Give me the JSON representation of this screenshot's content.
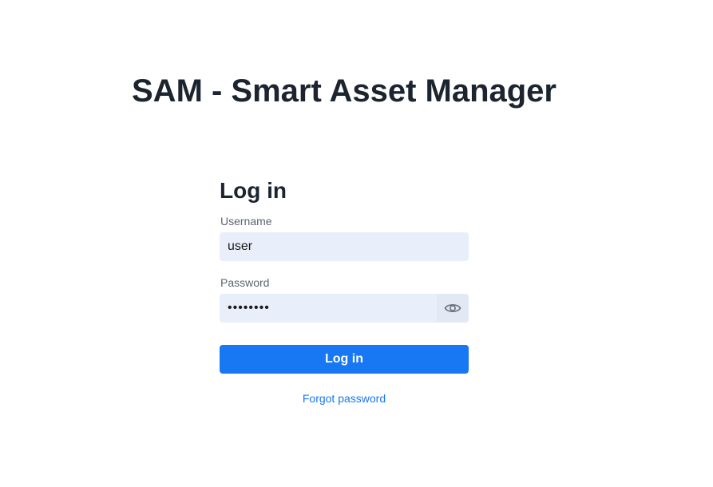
{
  "app": {
    "title": "SAM - Smart Asset Manager"
  },
  "login": {
    "heading": "Log in",
    "username": {
      "label": "Username",
      "value": "user"
    },
    "password": {
      "label": "Password",
      "value": "password",
      "toggle_icon": "eye-icon"
    },
    "submit_label": "Log in",
    "forgot_label": "Forgot password"
  },
  "colors": {
    "accent": "#1877f2",
    "input_bg": "#e8eefa",
    "title": "#1c2430",
    "label": "#5c6470"
  }
}
